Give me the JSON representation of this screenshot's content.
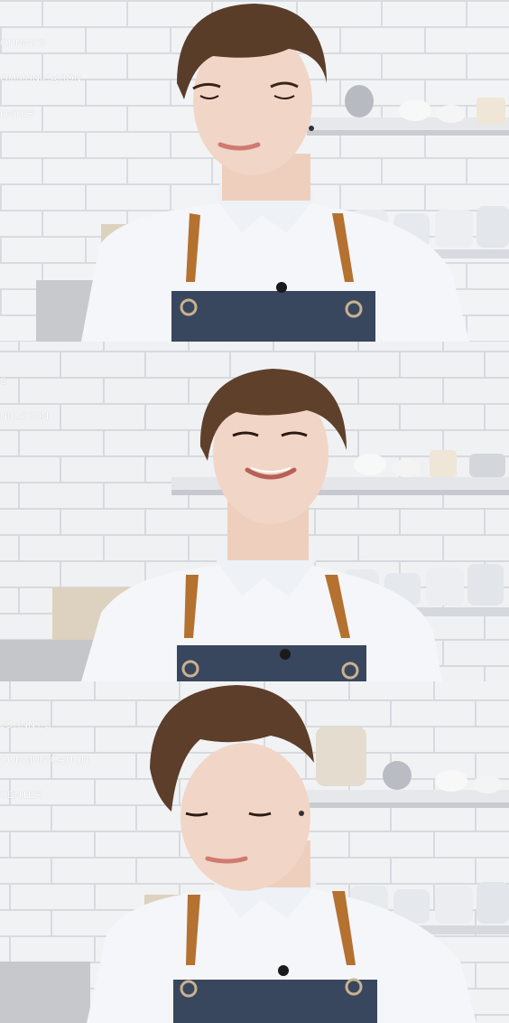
{
  "frames": [
    {
      "watermark": [
        "OHNNY'S",
        "OMMUNICATION",
        "ENTER"
      ]
    },
    {
      "watermark": [
        "S",
        "NICATION"
      ]
    },
    {
      "watermark": [
        "JOHNNY'S",
        "COMMUNICATION",
        "CENTER"
      ]
    }
  ],
  "colors": {
    "tile": "#f2f3f5",
    "grout": "#d9dce1",
    "shirt": "#f4f6fa",
    "apron": "#39475e",
    "strap": "#b4712f",
    "hair": "#5a3d29",
    "skin": "#f0d3c3"
  }
}
